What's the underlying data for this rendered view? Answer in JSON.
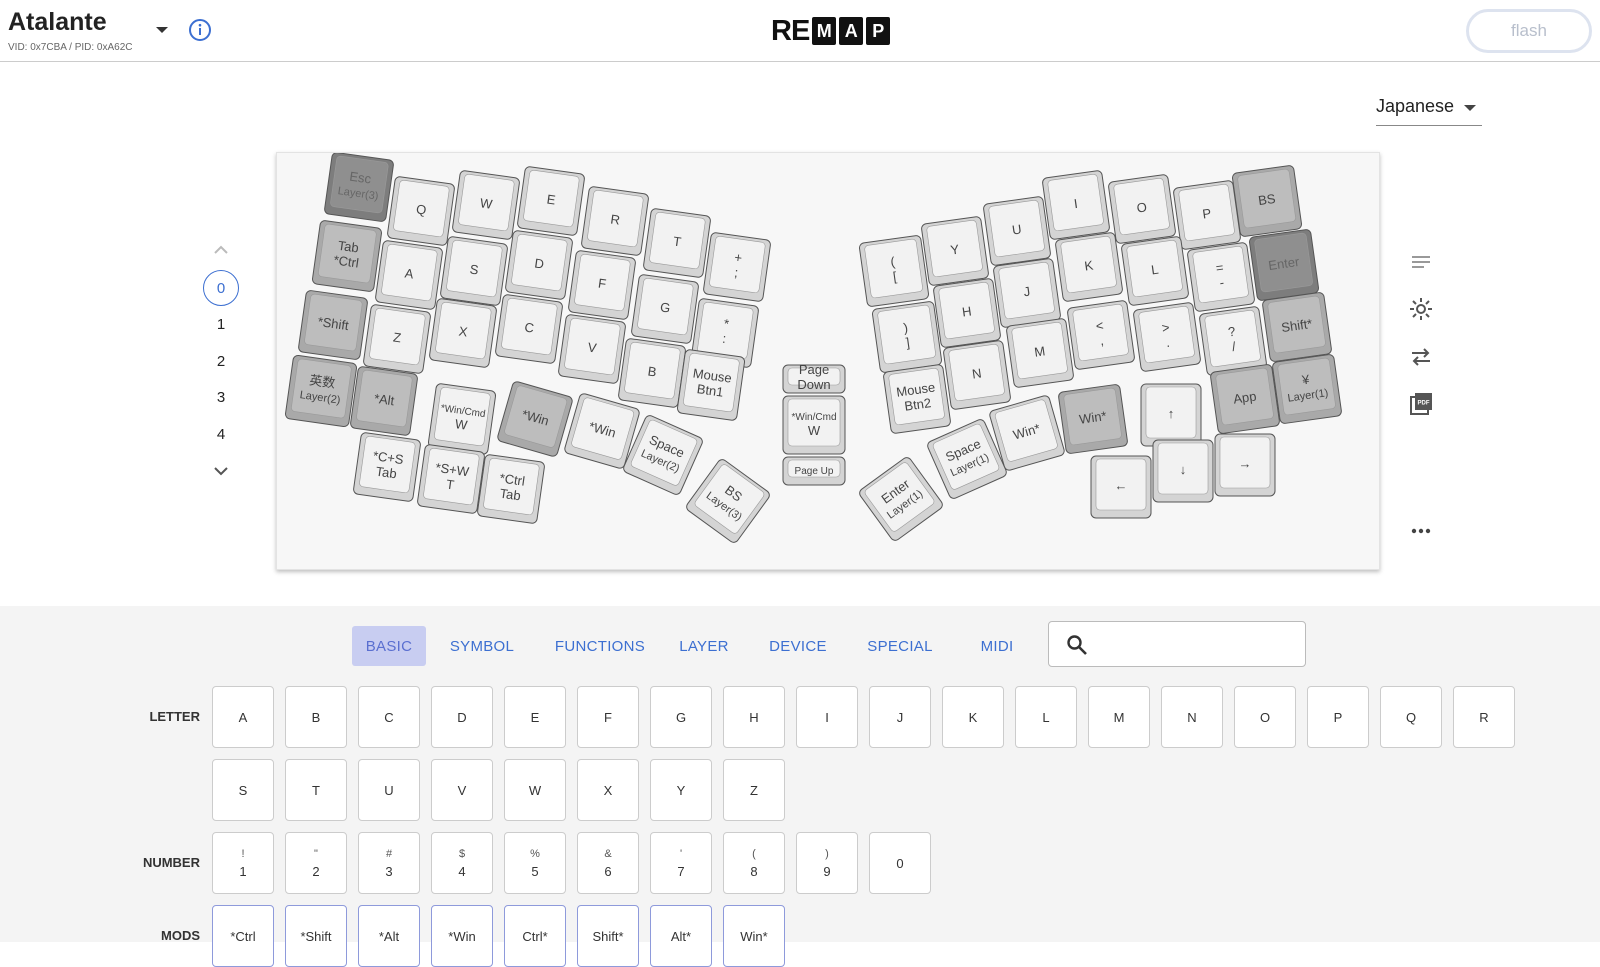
{
  "header": {
    "keyboard_name": "Atalante",
    "ids": "VID: 0x7CBA / PID: 0xA62C",
    "logo_re": "RE",
    "logo_letters": [
      "M",
      "A",
      "P"
    ],
    "flash_label": "flash"
  },
  "language": {
    "selected": "Japanese"
  },
  "layers": {
    "items": [
      "0",
      "1",
      "2",
      "3",
      "4"
    ],
    "active_index": 0
  },
  "tools": {
    "icons": [
      "menu-lines-icon",
      "lighting-icon",
      "swap-icon",
      "pdf-icon",
      "more-icon"
    ]
  },
  "keyboard": {
    "keys": [
      {
        "l1": "Esc",
        "l2": "Layer(3)",
        "dark": true
      },
      {
        "l1": "Q"
      },
      {
        "l1": "W"
      },
      {
        "l1": "E"
      },
      {
        "l1": "R"
      },
      {
        "l1": "T"
      },
      {
        "l1": "+",
        "l2": ";"
      },
      {
        "l1": "Tab",
        "l2": "*Ctrl",
        "gray": true
      },
      {
        "l1": "A"
      },
      {
        "l1": "S"
      },
      {
        "l1": "D"
      },
      {
        "l1": "F"
      },
      {
        "l1": "G"
      },
      {
        "l1": "*",
        "l2": ":"
      },
      {
        "l1": "*Shift",
        "gray": true
      },
      {
        "l1": "Z"
      },
      {
        "l1": "X"
      },
      {
        "l1": "C"
      },
      {
        "l1": "V"
      },
      {
        "l1": "B"
      },
      {
        "l1": "Mouse",
        "l2": "Btn1"
      },
      {
        "l1": "英数",
        "l2": "Layer(2)",
        "gray": true
      },
      {
        "l1": "*Alt",
        "gray": true
      },
      {
        "l1": "*Win/Cmd",
        "l2": "W"
      },
      {
        "l1": "*Win",
        "gray": true
      },
      {
        "l1": "*Win"
      },
      {
        "l1": "Space",
        "l2": "Layer(2)"
      },
      {
        "l1": "*C+S",
        "l2": "Tab"
      },
      {
        "l1": "*S+W",
        "l2": "T"
      },
      {
        "l1": "*Ctrl",
        "l2": "Tab"
      },
      {
        "l1": "BS",
        "l2": "Layer(3)"
      },
      {
        "l1": "Page",
        "l2": "Down"
      },
      {
        "l1": "*Win/Cmd",
        "l2": "W"
      },
      {
        "l1": "Page Up"
      },
      {
        "l1": "(",
        "l2": "["
      },
      {
        "l1": "Y"
      },
      {
        "l1": "U"
      },
      {
        "l1": "I"
      },
      {
        "l1": "O"
      },
      {
        "l1": "P"
      },
      {
        "l1": "BS",
        "gray": true
      },
      {
        "l1": ")",
        "l2": "]"
      },
      {
        "l1": "H"
      },
      {
        "l1": "J"
      },
      {
        "l1": "K"
      },
      {
        "l1": "L"
      },
      {
        "l1": "=",
        "l2": "-"
      },
      {
        "l1": "Enter",
        "dark": true
      },
      {
        "l1": "N"
      },
      {
        "l1": "M"
      },
      {
        "l1": "<",
        "l2": ","
      },
      {
        "l1": ">",
        "l2": "."
      },
      {
        "l1": "?",
        "l2": "/"
      },
      {
        "l1": "Shift*",
        "gray": true
      },
      {
        "l1": "Mouse",
        "l2": "Btn2"
      },
      {
        "l1": "Win*"
      },
      {
        "l1": "Win*",
        "gray": true
      },
      {
        "l1": "↑"
      },
      {
        "l1": "App",
        "gray": true
      },
      {
        "l1": "¥",
        "l2": "Layer(1)",
        "gray": true
      },
      {
        "l1": "Space",
        "l2": "Layer(1)"
      },
      {
        "l1": "←"
      },
      {
        "l1": "↓"
      },
      {
        "l1": "→"
      },
      {
        "l1": "Enter",
        "l2": "Layer(1)"
      }
    ]
  },
  "panel": {
    "tabs": [
      {
        "label": "BASIC",
        "active": true
      },
      {
        "label": "SYMBOL"
      },
      {
        "label": "FUNCTIONS"
      },
      {
        "label": "LAYER"
      },
      {
        "label": "DEVICE"
      },
      {
        "label": "SPECIAL"
      },
      {
        "label": "MIDI"
      }
    ],
    "search_placeholder": "",
    "rows": [
      {
        "label": "LETTER",
        "keys": [
          [
            "",
            "A"
          ],
          [
            "",
            "B"
          ],
          [
            "",
            "C"
          ],
          [
            "",
            "D"
          ],
          [
            "",
            "E"
          ],
          [
            "",
            "F"
          ],
          [
            "",
            "G"
          ],
          [
            "",
            "H"
          ],
          [
            "",
            "I"
          ],
          [
            "",
            "J"
          ],
          [
            "",
            "K"
          ],
          [
            "",
            "L"
          ],
          [
            "",
            "M"
          ],
          [
            "",
            "N"
          ],
          [
            "",
            "O"
          ],
          [
            "",
            "P"
          ],
          [
            "",
            "Q"
          ],
          [
            "",
            "R"
          ],
          [
            "",
            "S"
          ],
          [
            "",
            "T"
          ],
          [
            "",
            "U"
          ],
          [
            "",
            "V"
          ],
          [
            "",
            "W"
          ],
          [
            "",
            "X"
          ],
          [
            "",
            "Y"
          ],
          [
            "",
            "Z"
          ]
        ]
      },
      {
        "label": "NUMBER",
        "keys": [
          [
            "!",
            "1"
          ],
          [
            "\"",
            "2"
          ],
          [
            "#",
            "3"
          ],
          [
            "$",
            "4"
          ],
          [
            "%",
            "5"
          ],
          [
            "&",
            "6"
          ],
          [
            "'",
            "7"
          ],
          [
            "(",
            "8"
          ],
          [
            ")",
            "9"
          ],
          [
            "",
            "0"
          ]
        ]
      },
      {
        "label": "MODS",
        "keys": [
          [
            "",
            "*Ctrl"
          ],
          [
            "",
            "*Shift"
          ],
          [
            "",
            "*Alt"
          ],
          [
            "",
            "*Win"
          ],
          [
            "",
            "Ctrl*"
          ],
          [
            "",
            "Shift*"
          ],
          [
            "",
            "Alt*"
          ],
          [
            "",
            "Win*"
          ]
        ]
      }
    ]
  }
}
